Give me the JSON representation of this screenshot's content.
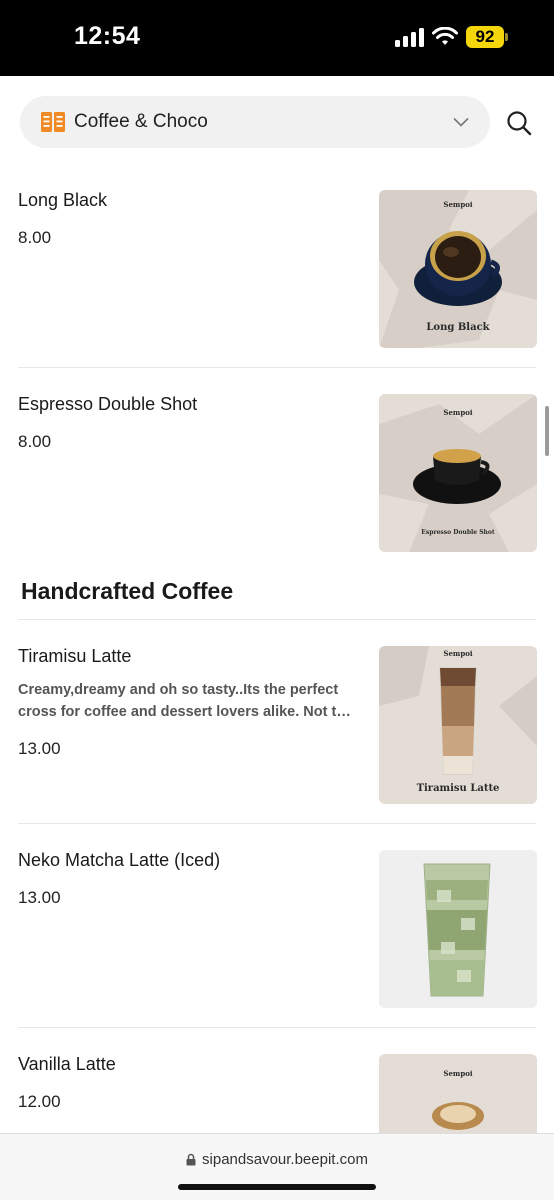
{
  "status_bar": {
    "time": "12:54",
    "battery": "92",
    "icons": [
      "signal-icon",
      "wifi-icon",
      "battery-icon"
    ]
  },
  "header": {
    "category_icon": "menu-book-icon",
    "category": "Coffee & Choco",
    "dropdown_icon": "chevron-down-icon",
    "search_icon": "search-icon"
  },
  "items_top": [
    {
      "name": "Long Black",
      "price": "8.00",
      "image_caption": "Long Black",
      "image_brand": "Sempoi"
    },
    {
      "name": "Espresso Double Shot",
      "price": "8.00",
      "image_caption": "Espresso Double Shot",
      "image_brand": "Sempoi"
    }
  ],
  "section": {
    "title": "Handcrafted Coffee"
  },
  "items_section": [
    {
      "name": "Tiramisu Latte",
      "description": "Creamy,dreamy and oh so tasty..Its the perfect cross for coffee and dessert lovers alike. Not too sweet, not too bitter.",
      "price": "13.00",
      "image_caption": "Tiramisu Latte",
      "image_brand": "Sempoi"
    },
    {
      "name": "Neko Matcha Latte (Iced)",
      "price": "13.00"
    },
    {
      "name": "Vanilla Latte",
      "price": "12.00",
      "image_brand": "Sempoi"
    }
  ],
  "browser": {
    "url": "sipandsavour.beepit.com"
  },
  "colors": {
    "accent": "#f08a24",
    "battery": "#f5d60a",
    "background": "#ffffff",
    "pill": "#f1f1f1"
  }
}
